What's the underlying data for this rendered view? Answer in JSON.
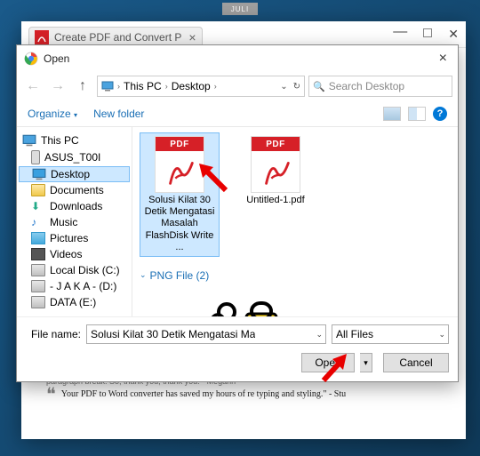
{
  "month_tag": "JULI",
  "browser": {
    "tab_title": "Create PDF and Convert P"
  },
  "dialog": {
    "title": "Open",
    "breadcrumb": {
      "root": "This PC",
      "folder": "Desktop"
    },
    "search_placeholder": "Search Desktop",
    "toolbar": {
      "organize": "Organize",
      "new_folder": "New folder",
      "help": "?"
    },
    "tree": {
      "top": "This PC",
      "items": [
        {
          "label": "ASUS_T00I"
        },
        {
          "label": "Desktop",
          "selected": true
        },
        {
          "label": "Documents"
        },
        {
          "label": "Downloads"
        },
        {
          "label": "Music"
        },
        {
          "label": "Pictures"
        },
        {
          "label": "Videos"
        },
        {
          "label": "Local Disk (C:)"
        },
        {
          "label": "- J A K A - (D:)"
        },
        {
          "label": "DATA (E:)"
        }
      ]
    },
    "files": {
      "pdf1_band": "PDF",
      "pdf1_name": "Solusi Kilat 30 Detik Mengatasi Masalah FlashDisk Write ...",
      "pdf2_band": "PDF",
      "pdf2_name": "Untitled-1.pdf",
      "group_png": "PNG File (2)"
    },
    "footer": {
      "file_name_label": "File name:",
      "file_name_value": "Solusi Kilat 30 Detik Mengatasi Ma",
      "type_value": "All Files",
      "open": "Open",
      "cancel": "Cancel"
    }
  },
  "testimonial": {
    "faded": "paragraph break. So, thank you, thank you.  - Megann",
    "quote": "Your PDF to Word converter has saved my hours of re typing and styling.\" - Stu"
  }
}
